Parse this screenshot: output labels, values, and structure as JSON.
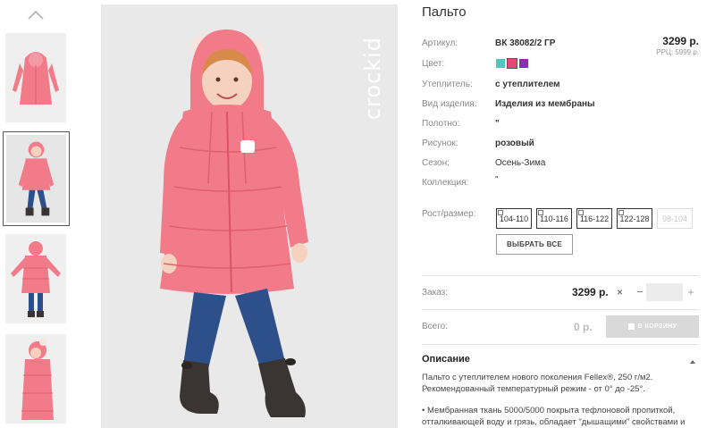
{
  "gallery": {
    "thumbnails": [
      {
        "icon": "thumbnail-front-hood-up"
      },
      {
        "icon": "thumbnail-child-front"
      },
      {
        "icon": "thumbnail-child-back"
      },
      {
        "icon": "thumbnail-child-side"
      }
    ],
    "active_index": 1,
    "brand_watermark": "crockid"
  },
  "product": {
    "title": "Пальто",
    "price": "3299 р.",
    "rrp": "РРЦ: 5999 р.",
    "attributes": [
      {
        "label": "Артикул:",
        "value": "ВК 38082/2 ГР"
      },
      {
        "label": "Цвет:",
        "value": ""
      },
      {
        "label": "Утеплитель:",
        "value": "с утеплителем"
      },
      {
        "label": "Вид изделия:",
        "value": "Изделия из мембраны"
      },
      {
        "label": "Полотно:",
        "value": "\""
      },
      {
        "label": "Рисунок:",
        "value": "розовый"
      },
      {
        "label": "Сезон:",
        "value": "Осень-Зима"
      },
      {
        "label": "Коллекция:",
        "value": "\""
      }
    ],
    "colors": [
      {
        "name": "teal",
        "hex": "#4fc7c1",
        "selected": false
      },
      {
        "name": "pink",
        "hex": "#e8457a",
        "selected": true
      },
      {
        "name": "purple",
        "hex": "#8e2bb0",
        "selected": false
      }
    ],
    "size_label": "Рост/размер:",
    "sizes": [
      {
        "label": "104-110",
        "available": true
      },
      {
        "label": "110-116",
        "available": true
      },
      {
        "label": "116-122",
        "available": true
      },
      {
        "label": "122-128",
        "available": true
      },
      {
        "label": "98-104",
        "available": false
      }
    ],
    "select_all_label": "ВЫБРАТЬ ВСЕ"
  },
  "order": {
    "label": "Заказ:",
    "price": "3299 р.",
    "remove_symbol": "×",
    "minus": "−",
    "plus": "+",
    "quantity": ""
  },
  "total": {
    "label": "Всего:",
    "value": "0 р.",
    "cart_label": "В КОРЗИНУ"
  },
  "description": {
    "heading": "Описание",
    "lines": [
      "Пальто с утеплителем нового поколения Fellex®, 250 г/м2.",
      "Рекомендованный температурный режим - от 0° до -25°.",
      "",
      "• Мембранная ткань 5000/5000 покрыта тефлоновой пропиткой,",
      "отталкивающей воду и грязь, обладает \"дышащими\" свойствами и"
    ]
  },
  "colors": {
    "coat": "#f27b8a",
    "coat_shade": "#e0606f",
    "jeans": "#2d4f8a",
    "boots": "#3a3533",
    "backdrop": "#e9e9e9"
  }
}
